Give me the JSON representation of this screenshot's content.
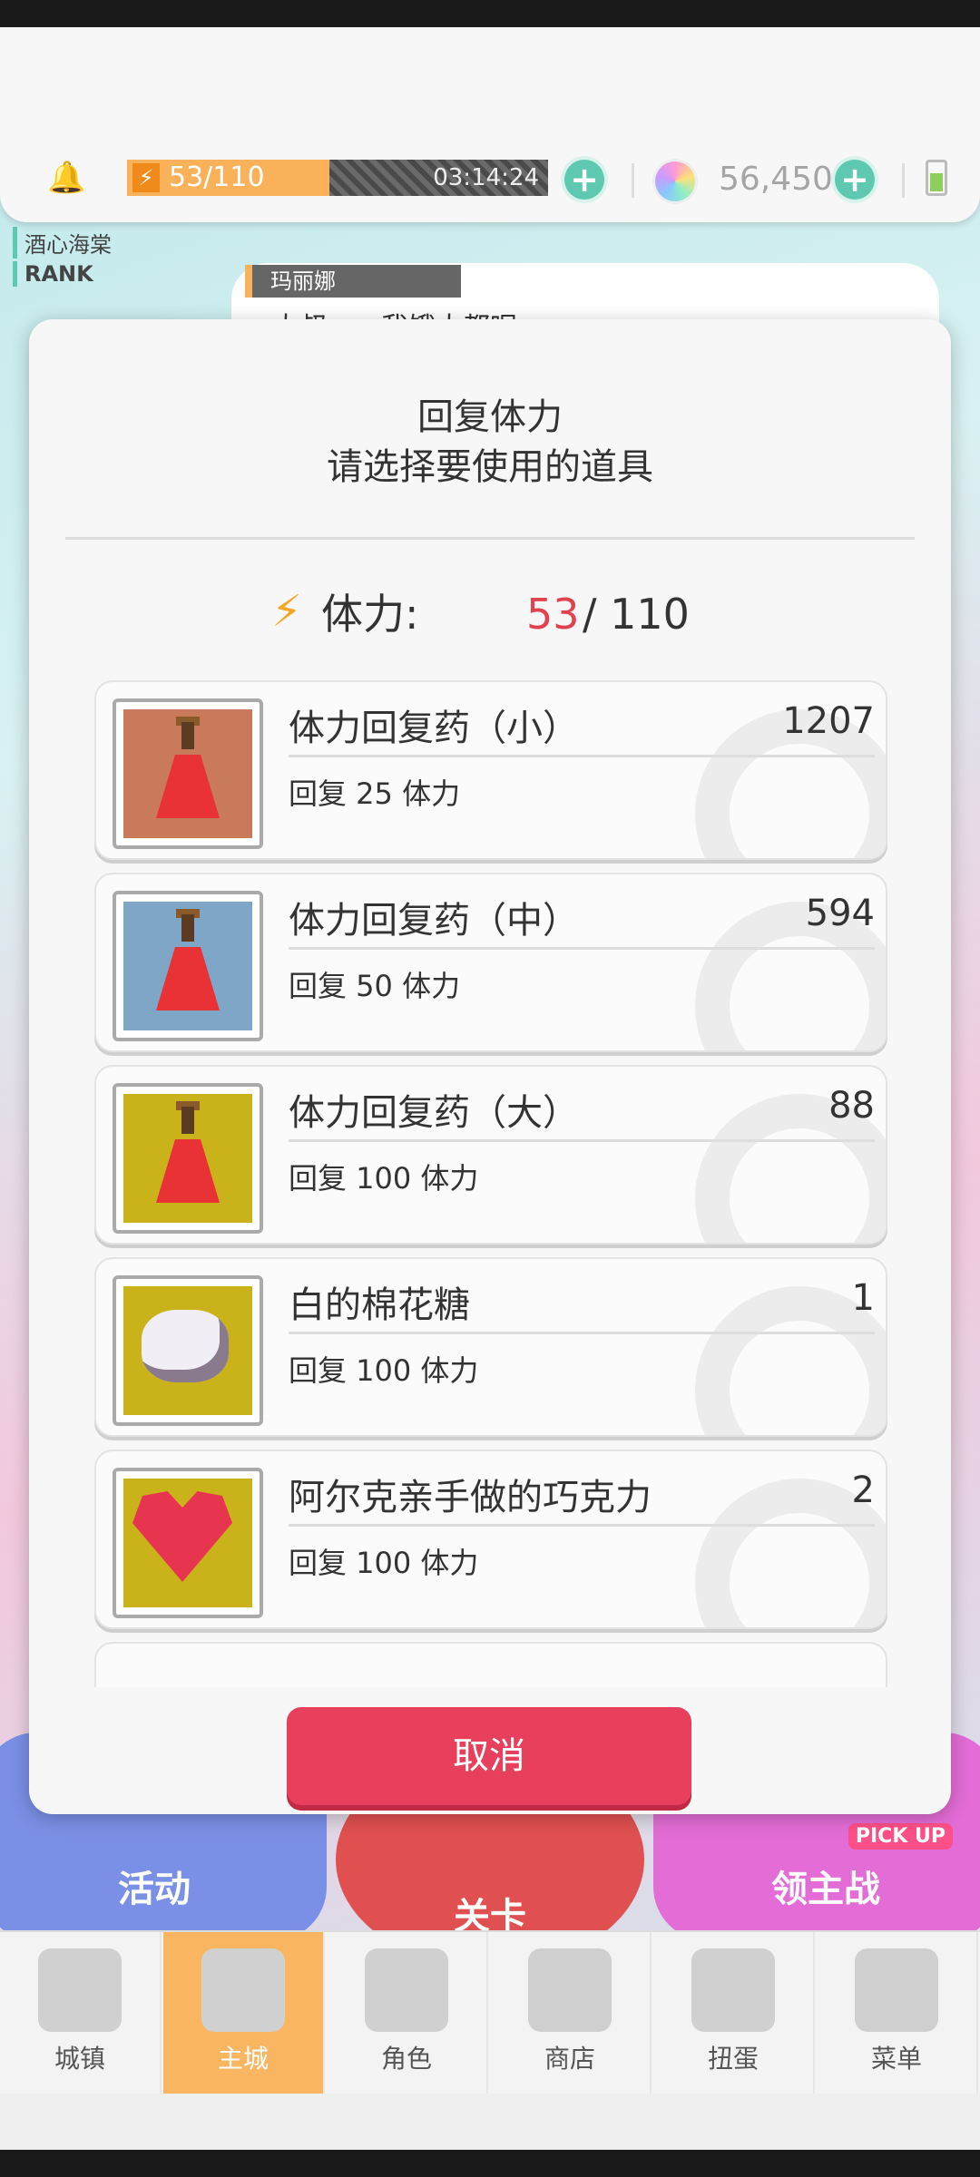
{
  "topbar": {
    "stamina_text": "53/110",
    "stamina_fraction": 0.48,
    "timer": "03:14:24",
    "gems": "56,450",
    "plus": "+"
  },
  "background": {
    "player_name": "酒心海棠",
    "rank_label": "RANK",
    "speaker": "玛丽娜",
    "dialogue": "大叔……我饿大都呢",
    "btn_event": "活动",
    "btn_stage": "关卡",
    "btn_boss": "领主战",
    "pickup": "PICK UP"
  },
  "dialog": {
    "title": "回复体力",
    "subtitle": "请选择要使用的道具",
    "stamina_label": "体力:",
    "stamina_current": "53",
    "stamina_max": "/ 110",
    "items": [
      {
        "name": "体力回复药（小）",
        "count": "1207",
        "desc": "回复 25 体力",
        "thumb": "small-potion-icon",
        "bg": "#c97a5a"
      },
      {
        "name": "体力回复药（中）",
        "count": "594",
        "desc": "回复 50 体力",
        "thumb": "medium-potion-icon",
        "bg": "#7fa6c6"
      },
      {
        "name": "体力回复药（大）",
        "count": "88",
        "desc": "回复 100 体力",
        "thumb": "large-potion-icon",
        "bg": "#c9b21a"
      },
      {
        "name": "白的棉花糖",
        "count": "1",
        "desc": "回复 100 体力",
        "thumb": "marshmallow-icon",
        "bg": "#c9b21a"
      },
      {
        "name": "阿尔克亲手做的巧克力",
        "count": "2",
        "desc": "回复 100 体力",
        "thumb": "chocolate-icon",
        "bg": "#c9b21a"
      }
    ],
    "cancel_label": "取消"
  },
  "nav": [
    {
      "label": "城镇",
      "icon": "town-icon",
      "active": false
    },
    {
      "label": "主城",
      "icon": "main-city-icon",
      "active": true
    },
    {
      "label": "角色",
      "icon": "character-icon",
      "active": false
    },
    {
      "label": "商店",
      "icon": "shop-icon",
      "active": false
    },
    {
      "label": "扭蛋",
      "icon": "gacha-icon",
      "active": false
    },
    {
      "label": "菜单",
      "icon": "menu-icon",
      "active": false
    }
  ]
}
